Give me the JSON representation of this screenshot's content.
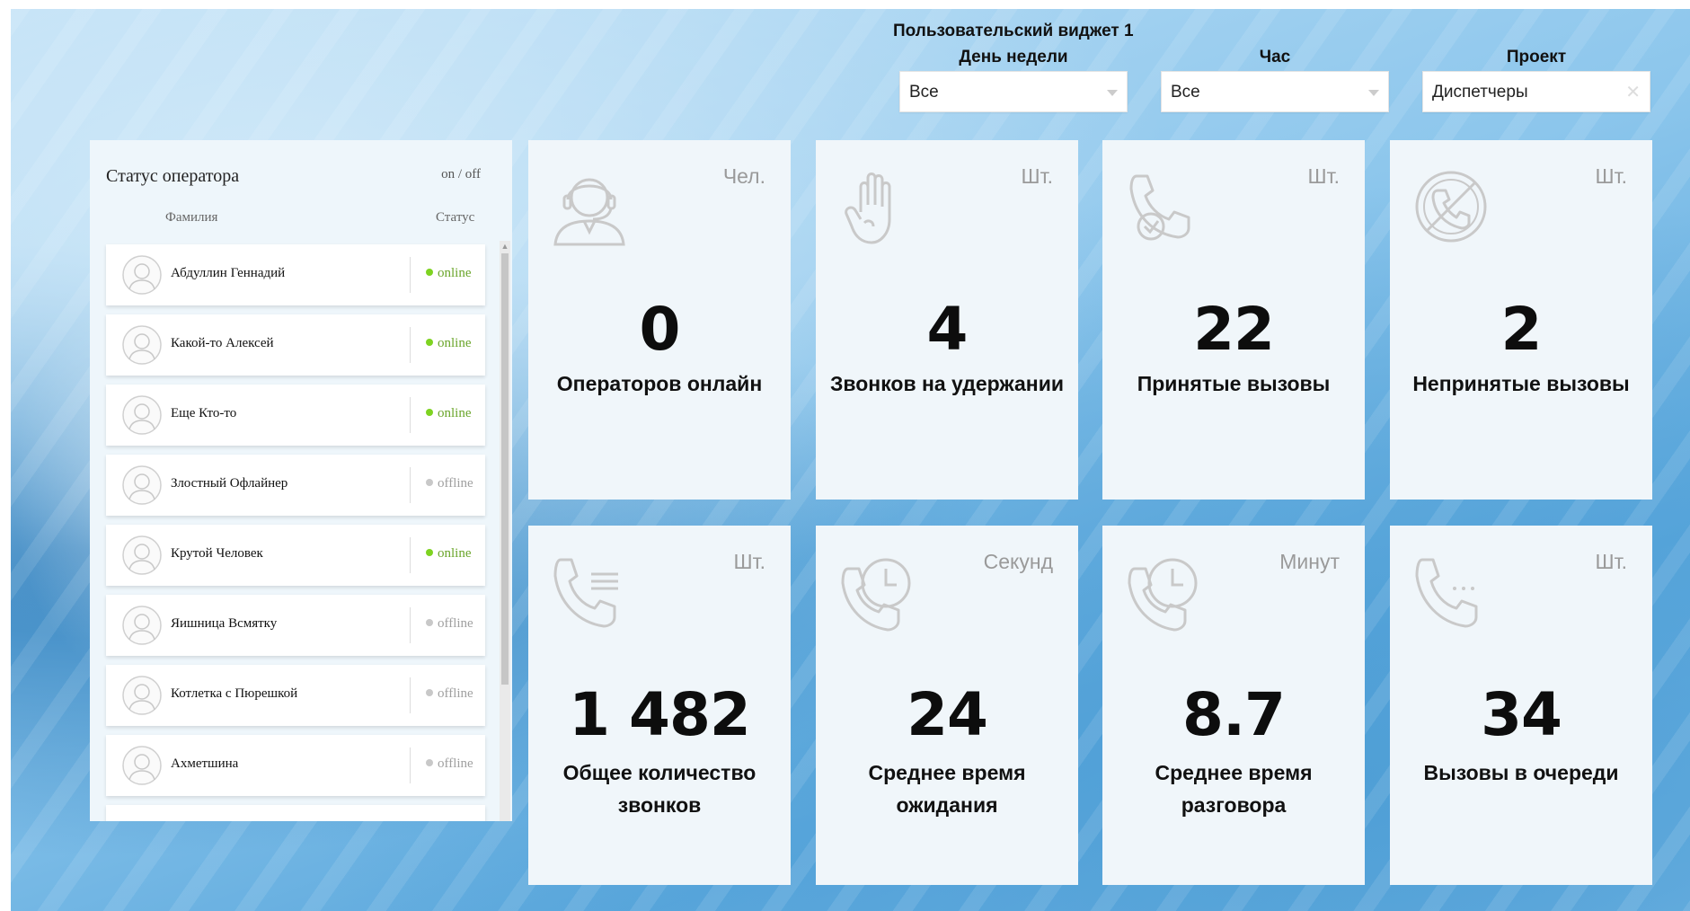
{
  "header": {
    "widget_title": "Пользовательский виджет 1",
    "filters": [
      {
        "label": "День недели",
        "value": "Все",
        "control": "dropdown"
      },
      {
        "label": "Час",
        "value": "Все",
        "control": "dropdown"
      },
      {
        "label": "Проект",
        "value": "Диспетчеры",
        "control": "clear"
      }
    ]
  },
  "operator_panel": {
    "title": "Статус оператора",
    "toggle": "on / off",
    "col_surname": "Фамилия",
    "col_status": "Статус",
    "operators": [
      {
        "name": "Абдуллин Геннадий",
        "status": "online"
      },
      {
        "name": "Какой-то Алексей",
        "status": "online"
      },
      {
        "name": "Еще Кто-то",
        "status": "online"
      },
      {
        "name": "Злостный Офлайнер",
        "status": "offline"
      },
      {
        "name": "Крутой Человек",
        "status": "online"
      },
      {
        "name": "Яишница Всмятку",
        "status": "offline"
      },
      {
        "name": "Котлетка с Пюрешкой",
        "status": "offline"
      },
      {
        "name": "Ахметшина",
        "status": "offline"
      }
    ],
    "colors": {
      "online": "#7ed321",
      "offline": "#c8c8c8",
      "online_text": "#6aa52a",
      "offline_text": "#a0a0a0"
    }
  },
  "cards": [
    {
      "icon": "operator-headset-icon",
      "unit": "Чел.",
      "value": "0",
      "label": "Операторов онлайн"
    },
    {
      "icon": "hand-stop-icon",
      "unit": "Шт.",
      "value": "4",
      "label": "Звонков на удержании"
    },
    {
      "icon": "phone-check-icon",
      "unit": "Шт.",
      "value": "22",
      "label": "Принятые вызовы"
    },
    {
      "icon": "phone-blocked-icon",
      "unit": "Шт.",
      "value": "2",
      "label": "Непринятые вызовы"
    },
    {
      "icon": "phone-list-icon",
      "unit": "Шт.",
      "value": "1 482",
      "label": "Общее количество звонков"
    },
    {
      "icon": "phone-clock-icon",
      "unit": "Секунд",
      "value": "24",
      "label": "Среднее время ожидания"
    },
    {
      "icon": "phone-clock-icon",
      "unit": "Минут",
      "value": "8.7",
      "label": "Среднее время разговора"
    },
    {
      "icon": "phone-dots-icon",
      "unit": "Шт.",
      "value": "34",
      "label": "Вызовы в очереди"
    }
  ]
}
